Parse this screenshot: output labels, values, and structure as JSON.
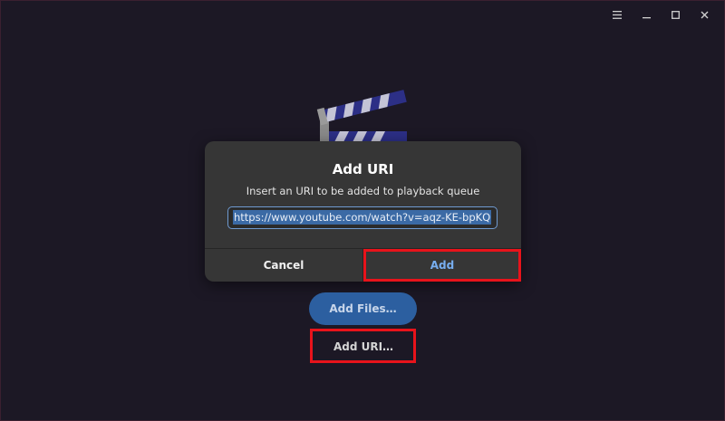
{
  "window": {
    "controls": {
      "menu_icon": "hamburger-icon",
      "minimize_icon": "minimize-icon",
      "maximize_icon": "maximize-icon",
      "close_icon": "close-icon"
    }
  },
  "dialog": {
    "title": "Add URI",
    "message": "Insert an URI to be added to playback queue",
    "uri_value": "https://www.youtube.com/watch?v=aqz-KE-bpKQ",
    "cancel_label": "Cancel",
    "add_label": "Add"
  },
  "main": {
    "add_files_label": "Add Files…",
    "add_uri_label": "Add URI…"
  },
  "colors": {
    "background": "#1c1825",
    "dialog": "#363636",
    "accent": "#2c5fa0",
    "add_text": "#78aef0",
    "highlight": "#e8131b"
  }
}
